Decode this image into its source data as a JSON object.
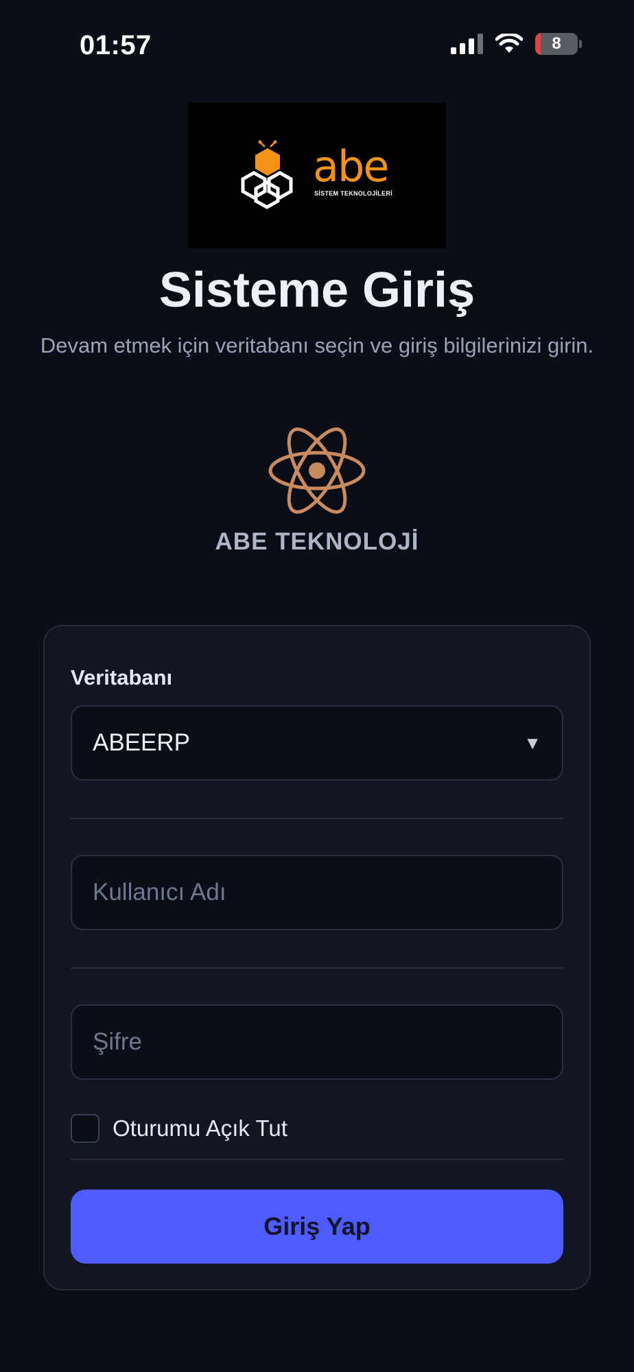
{
  "status_bar": {
    "time": "01:57",
    "battery": "8",
    "icons": [
      "signal-icon",
      "wifi-icon",
      "battery-icon"
    ]
  },
  "logo": {
    "text": "abe",
    "subtext": "SİSTEM TEKNOLOJİLERİ",
    "icon": "honeycomb-bee-logo"
  },
  "header": {
    "title": "Sisteme Giriş",
    "subtitle": "Devam etmek için veritabanı seçin ve giriş bilgilerinizi girin."
  },
  "brand": {
    "icon": "atom-icon",
    "name": "ABE TEKNOLOJİ"
  },
  "form": {
    "database_label": "Veritabanı",
    "database_value": "ABEERP",
    "username_placeholder": "Kullanıcı Adı",
    "password_placeholder": "Şifre",
    "remember_label": "Oturumu Açık Tut",
    "remember_checked": false,
    "submit_label": "Giriş Yap"
  },
  "colors": {
    "background": "#0b0e17",
    "card": "#111622",
    "accent": "#4d5bff",
    "brand_orange": "#f39214",
    "atom": "#c98a5e"
  }
}
